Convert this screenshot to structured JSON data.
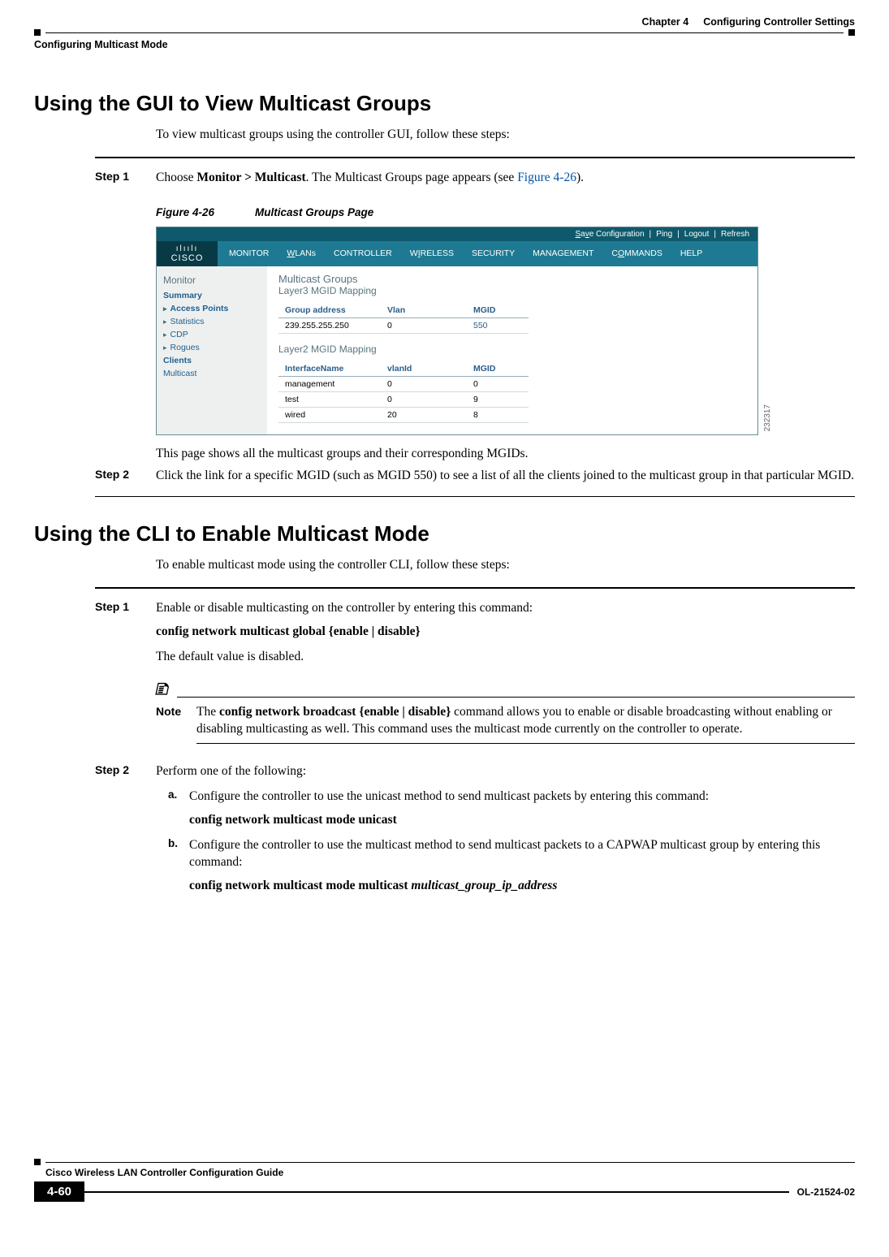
{
  "header": {
    "chapter": "Chapter 4",
    "chapter_title": "Configuring Controller Settings",
    "section": "Configuring Multicast Mode"
  },
  "section1": {
    "title": "Using the GUI to View Multicast Groups",
    "intro": "To view multicast groups using the controller GUI, follow these steps:",
    "step1_label": "Step 1",
    "step1_text_a": "Choose ",
    "step1_text_bold": "Monitor > Multicast",
    "step1_text_b": ". The Multicast Groups page appears (see ",
    "step1_link": "Figure 4-26",
    "step1_text_c": ").",
    "fig_num": "Figure 4-26",
    "fig_title": "Multicast Groups Page",
    "fig_id": "232317",
    "below_fig": "This page shows all the multicast groups and their corresponding MGIDs.",
    "step2_label": "Step 2",
    "step2_text": "Click the link for a specific MGID (such as MGID 550) to see a list of all the clients joined to the multicast group in that particular MGID."
  },
  "screenshot": {
    "topbar": {
      "save": "Save Configuration",
      "ping": "Ping",
      "logout": "Logout",
      "refresh": "Refresh"
    },
    "logo_bars": "ılıılı",
    "logo": "CISCO",
    "nav": [
      "MONITOR",
      "WLANs",
      "CONTROLLER",
      "WIRELESS",
      "SECURITY",
      "MANAGEMENT",
      "COMMANDS",
      "HELP"
    ],
    "side_title": "Monitor",
    "side_items": [
      "Summary",
      "Access Points",
      "Statistics",
      "CDP",
      "Rogues",
      "Clients",
      "Multicast"
    ],
    "main_title": "Multicast Groups",
    "main_sub": "Layer3 MGID Mapping",
    "t1_headers": [
      "Group address",
      "Vlan",
      "MGID"
    ],
    "t1_rows": [
      [
        "239.255.255.250",
        "0",
        "550"
      ]
    ],
    "main_sub2": "Layer2 MGID Mapping",
    "t2_headers": [
      "InterfaceName",
      "vlanId",
      "MGID"
    ],
    "t2_rows": [
      [
        "management",
        "0",
        "0"
      ],
      [
        "test",
        "0",
        "9"
      ],
      [
        "wired",
        "20",
        "8"
      ]
    ]
  },
  "section2": {
    "title": "Using the CLI to Enable Multicast Mode",
    "intro": "To enable multicast mode using the controller CLI, follow these steps:",
    "step1_label": "Step 1",
    "step1_text": "Enable or disable multicasting on the controller by entering this command:",
    "step1_cmd": "config network multicast global {enable | disable}",
    "step1_default": "The default value is disabled.",
    "note_label": "Note",
    "note_text_a": "The ",
    "note_bold": "config network broadcast {enable | disable}",
    "note_text_b": " command allows you to enable or disable broadcasting without enabling or disabling multicasting as well. This command uses the multicast mode currently on the controller to operate.",
    "step2_label": "Step 2",
    "step2_text": "Perform one of the following:",
    "sub_a_label": "a.",
    "sub_a_text": "Configure the controller to use the unicast method to send multicast packets by entering this command:",
    "sub_a_cmd": "config network multicast mode unicast",
    "sub_b_label": "b.",
    "sub_b_text": "Configure the controller to use the multicast method to send multicast packets to a CAPWAP multicast group by entering this command:",
    "sub_b_cmd_a": "config network multicast mode multicast ",
    "sub_b_cmd_i": "multicast_group_ip_address"
  },
  "footer": {
    "guide": "Cisco Wireless LAN Controller Configuration Guide",
    "page": "4-60",
    "doc": "OL-21524-02"
  }
}
